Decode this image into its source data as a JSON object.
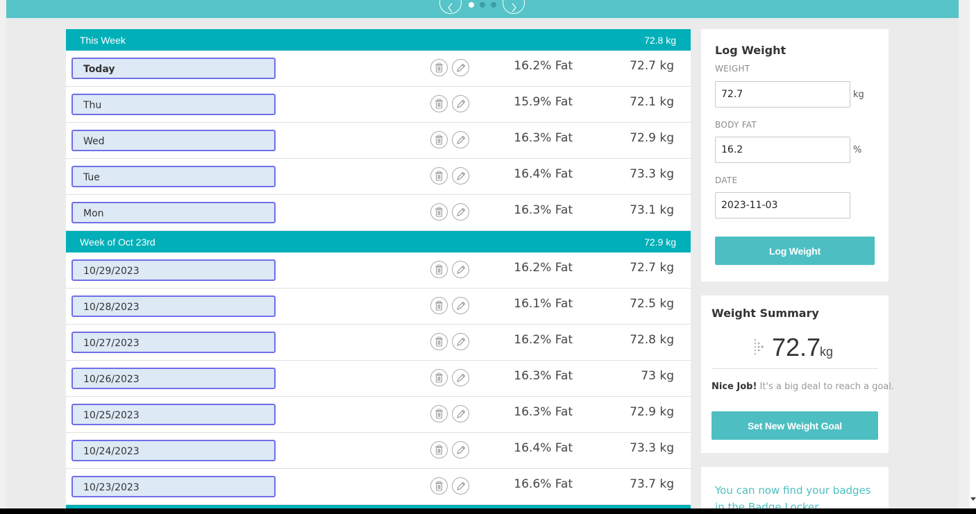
{
  "carousel": {
    "prev_icon": "chevron-left-icon",
    "next_icon": "chevron-right-icon",
    "dots": [
      {
        "active": true
      },
      {
        "active": false
      },
      {
        "active": false
      }
    ]
  },
  "weeks": [
    {
      "title": "This Week",
      "average": "72.8 kg",
      "entries": [
        {
          "date": "Today",
          "fat": "16.2% Fat",
          "weight": "72.7 kg"
        },
        {
          "date": "Thu",
          "fat": "15.9% Fat",
          "weight": "72.1 kg"
        },
        {
          "date": "Wed",
          "fat": "16.3% Fat",
          "weight": "72.9 kg"
        },
        {
          "date": "Tue",
          "fat": "16.4% Fat",
          "weight": "73.3 kg"
        },
        {
          "date": "Mon",
          "fat": "16.3% Fat",
          "weight": "73.1 kg"
        }
      ]
    },
    {
      "title": "Week of Oct 23rd",
      "average": "72.9 kg",
      "entries": [
        {
          "date": "10/29/2023",
          "fat": "16.2% Fat",
          "weight": "72.7 kg"
        },
        {
          "date": "10/28/2023",
          "fat": "16.1% Fat",
          "weight": "72.5 kg"
        },
        {
          "date": "10/27/2023",
          "fat": "16.2% Fat",
          "weight": "72.8 kg"
        },
        {
          "date": "10/26/2023",
          "fat": "16.3% Fat",
          "weight": "73 kg"
        },
        {
          "date": "10/25/2023",
          "fat": "16.3% Fat",
          "weight": "72.9 kg"
        },
        {
          "date": "10/24/2023",
          "fat": "16.4% Fat",
          "weight": "73.3 kg"
        },
        {
          "date": "10/23/2023",
          "fat": "16.6% Fat",
          "weight": "73.7 kg"
        }
      ]
    }
  ],
  "row_icons": {
    "delete": "trash-icon",
    "edit": "pencil-icon"
  },
  "log_weight": {
    "title": "Log Weight",
    "weight_label": "WEIGHT",
    "weight_value": "72.7",
    "weight_unit": "kg",
    "fat_label": "BODY FAT",
    "fat_value": "16.2",
    "fat_unit": "%",
    "date_label": "DATE",
    "date_value": "2023-11-03",
    "button": "Log Weight"
  },
  "summary": {
    "title": "Weight Summary",
    "icon": "fitbit-icon",
    "value": "72.7",
    "unit": "kg",
    "message_bold": "Nice Job!",
    "message": "It's a big deal to reach a goal.",
    "button": "Set New Weight Goal"
  },
  "badges": {
    "text": "You can now find your badges in the Badge Locker"
  },
  "colors": {
    "header_teal": "#00afb8",
    "button_teal": "#4dbfc2",
    "date_border": "#6f6ee8",
    "date_fill": "#dde9f5"
  }
}
